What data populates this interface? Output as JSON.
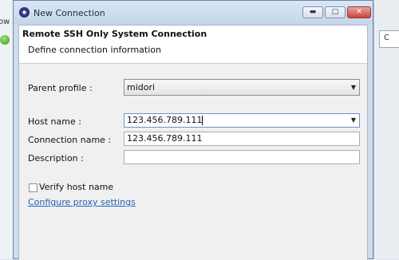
{
  "background": {
    "left_partial_text": "ow",
    "right_partial_text": "C"
  },
  "window": {
    "title": "New Connection",
    "minimize_glyph": "▬",
    "maximize_glyph": "□",
    "close_glyph": "✕"
  },
  "header": {
    "title": "Remote SSH Only System Connection",
    "description": "Define connection information"
  },
  "form": {
    "parent_profile": {
      "label": "Parent profile :",
      "value": "midori"
    },
    "host_name": {
      "label": "Host name :",
      "value": "123.456.789.111"
    },
    "connection_name": {
      "label": "Connection name :",
      "value": "123.456.789.111"
    },
    "description": {
      "label": "Description :",
      "value": ""
    },
    "verify_host": {
      "label": "Verify host name",
      "checked": false
    },
    "proxy_link": "Configure proxy settings"
  },
  "colors": {
    "link": "#1e62b4",
    "window_frame": "#cfdcec",
    "close_button": "#c7483c"
  }
}
